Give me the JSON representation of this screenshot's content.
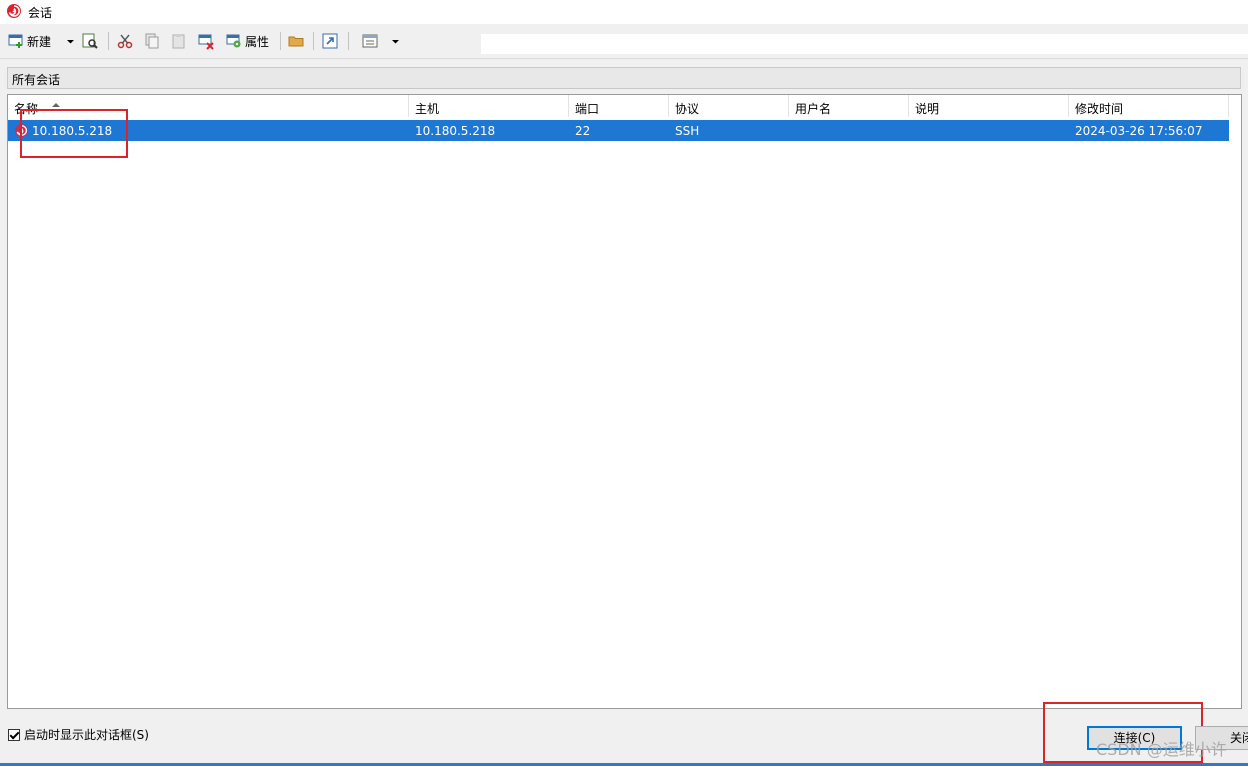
{
  "window": {
    "title": "会话",
    "icon": "xshell-spiral-icon"
  },
  "toolbar": {
    "new_label": "新建",
    "properties_label": "属性",
    "search_value": ""
  },
  "group": {
    "label": "所有会话"
  },
  "table": {
    "columns": [
      "名称",
      "主机",
      "端口",
      "协议",
      "用户名",
      "说明",
      "修改时间"
    ],
    "sort_column": "名称",
    "sort_direction": "ascending",
    "rows": [
      {
        "name": "10.180.5.218",
        "host": "10.180.5.218",
        "port": "22",
        "protocol": "SSH",
        "username": "",
        "description": "",
        "modified": "2024-03-26 17:56:07",
        "selected": true
      }
    ]
  },
  "footer": {
    "show_on_startup_label": "启动时显示此对话框(S)",
    "show_on_startup_checked": true,
    "connect_label": "连接(C)",
    "close_label": "关闭"
  },
  "watermark": "CSDN @运维小许",
  "colors": {
    "selection": "#1f77d4",
    "highlight_box": "#d9242a",
    "accent": "#0078d7"
  }
}
